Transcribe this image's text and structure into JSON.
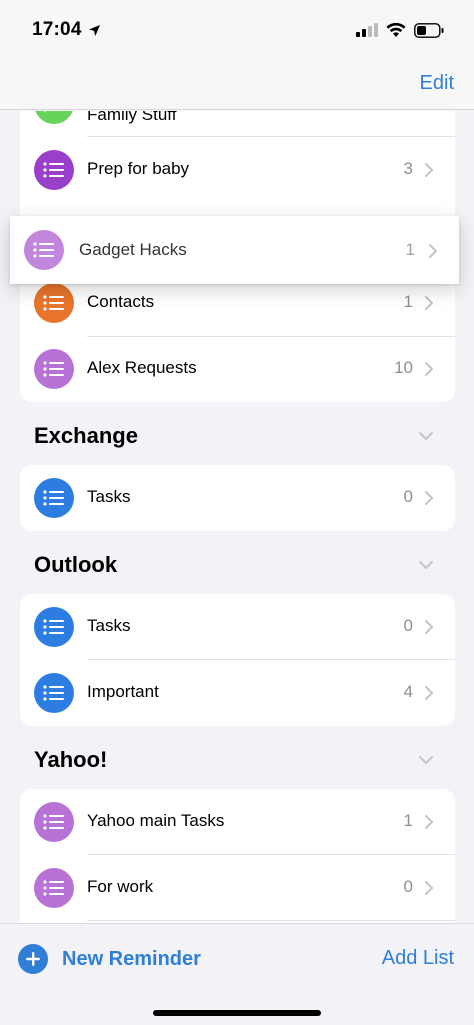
{
  "status": {
    "time": "17:04",
    "icons": [
      "location-arrow-icon",
      "signal-icon",
      "wifi-icon",
      "battery-icon"
    ]
  },
  "nav": {
    "edit_label": "Edit"
  },
  "colors": {
    "accent": "#2f7fd6",
    "purple": "#b872d6",
    "dark_purple": "#9a3fc9",
    "orange": "#e8752b",
    "green": "#68d35a",
    "blue": "#2d7de0"
  },
  "lists_top": [
    {
      "label": "Family Stuff",
      "count": "",
      "color": "#68d35a",
      "icon": "list-icon"
    },
    {
      "label": "Prep for baby",
      "count": "3",
      "color": "#9a3fc9",
      "icon": "list-icon"
    },
    {
      "label": "Contacts",
      "count": "1",
      "color": "#e8752b",
      "icon": "list-icon"
    },
    {
      "label": "Alex Requests",
      "count": "10",
      "color": "#b872d6",
      "icon": "list-icon"
    }
  ],
  "dragging": {
    "label": "Gadget Hacks",
    "count": "1",
    "color": "#b872d6",
    "icon": "list-icon"
  },
  "sections": [
    {
      "title": "Exchange",
      "items": [
        {
          "label": "Tasks",
          "count": "0",
          "color": "#2d7de0",
          "icon": "list-icon"
        }
      ]
    },
    {
      "title": "Outlook",
      "items": [
        {
          "label": "Tasks",
          "count": "0",
          "color": "#2d7de0",
          "icon": "list-icon"
        },
        {
          "label": "Important",
          "count": "4",
          "color": "#2d7de0",
          "icon": "list-icon"
        }
      ]
    },
    {
      "title": "Yahoo!",
      "items": [
        {
          "label": "Yahoo main Tasks",
          "count": "1",
          "color": "#b872d6",
          "icon": "list-icon"
        },
        {
          "label": "For work",
          "count": "0",
          "color": "#b872d6",
          "icon": "list-icon"
        }
      ]
    }
  ],
  "toolbar": {
    "new_reminder_label": "New Reminder",
    "add_list_label": "Add List"
  }
}
